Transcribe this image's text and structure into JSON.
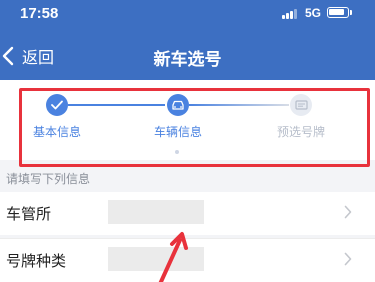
{
  "status": {
    "time": "17:58",
    "network": "5G"
  },
  "nav": {
    "back_label": "返回",
    "title": "新车选号"
  },
  "steps": [
    {
      "label": "基本信息",
      "state": "done"
    },
    {
      "label": "车辆信息",
      "state": "active"
    },
    {
      "label": "预选号牌",
      "state": "pending"
    }
  ],
  "hint": "请填写下列信息",
  "rows": [
    {
      "label": "车管所"
    },
    {
      "label": "号牌种类"
    }
  ],
  "colors": {
    "header": "#3d6fc2",
    "accent": "#4a82e0",
    "inactive": "#b6bdca",
    "highlight": "#e8323c"
  }
}
